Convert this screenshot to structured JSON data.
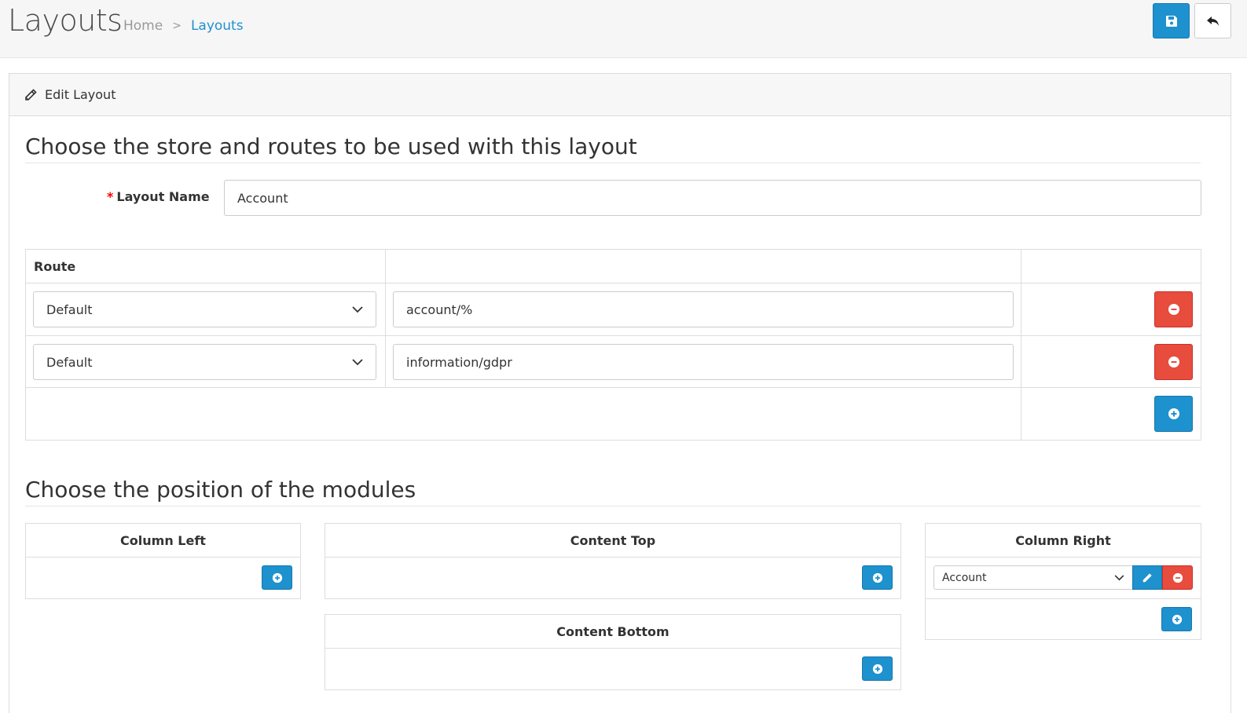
{
  "header": {
    "title": "Layouts",
    "breadcrumb": {
      "home": "Home",
      "separator": ">",
      "current": "Layouts"
    },
    "buttons": {
      "save_icon": "floppy-disk-icon",
      "back_icon": "reply-arrow-icon"
    }
  },
  "panel": {
    "heading": "Edit Layout",
    "heading_icon": "pencil-icon"
  },
  "routes_section": {
    "title": "Choose the store and routes to be used with this layout",
    "layout_name_label": "Layout Name",
    "required_mark": "*",
    "layout_name_value": "Account",
    "table_header": "Route",
    "rows": [
      {
        "store": "Default",
        "route": "account/%"
      },
      {
        "store": "Default",
        "route": "information/gdpr"
      }
    ]
  },
  "modules_section": {
    "title": "Choose the position of the modules",
    "column_left": {
      "label": "Column Left"
    },
    "content_top": {
      "label": "Content Top"
    },
    "content_bottom": {
      "label": "Content Bottom"
    },
    "column_right": {
      "label": "Column Right",
      "module_value": "Account"
    }
  },
  "colors": {
    "primary": "#1e91cf",
    "danger": "#e74c3c",
    "link": "#1e91cf"
  }
}
